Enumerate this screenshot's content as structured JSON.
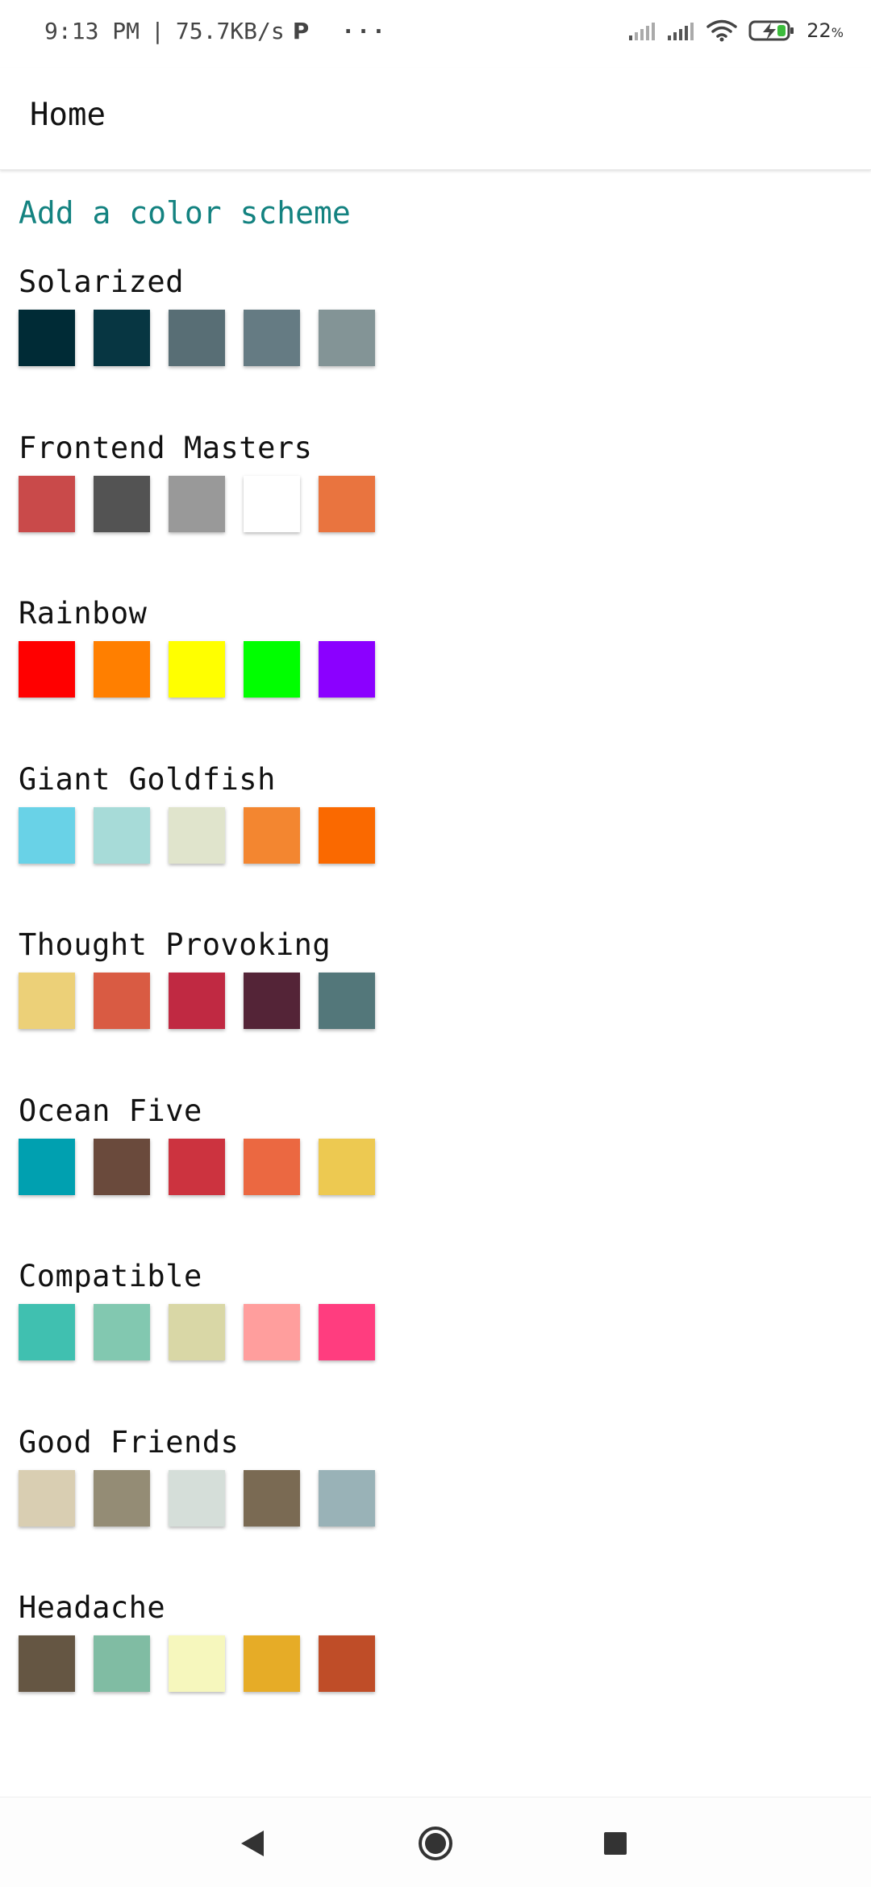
{
  "status_bar": {
    "time": "9:13 PM",
    "separator": "|",
    "network_speed": "75.7KB/s",
    "more": "···",
    "battery_level": "22",
    "battery_unit": "%"
  },
  "app_bar": {
    "title": "Home"
  },
  "add_scheme_label": "Add a color scheme",
  "colors": {
    "link": "#138280"
  },
  "schemes": [
    {
      "name": "Solarized",
      "colors": [
        "#002b36",
        "#073642",
        "#586e75",
        "#657b83",
        "#839496"
      ]
    },
    {
      "name": "Frontend Masters",
      "colors": [
        "#c94a4a",
        "#535353",
        "#999999",
        "#ffffff",
        "#e9743f"
      ]
    },
    {
      "name": "Rainbow",
      "colors": [
        "#ff0000",
        "#ff7f00",
        "#ffff00",
        "#00ff00",
        "#8b00ff"
      ]
    },
    {
      "name": "Giant Goldfish",
      "colors": [
        "#69d2e7",
        "#a7dbd8",
        "#e0e4cc",
        "#f38630",
        "#fa6900"
      ]
    },
    {
      "name": "Thought Provoking",
      "colors": [
        "#ecd078",
        "#d95b43",
        "#c02942",
        "#542437",
        "#53777a"
      ]
    },
    {
      "name": "Ocean Five",
      "colors": [
        "#00a0b0",
        "#6a4a3c",
        "#cc333f",
        "#eb6841",
        "#edc951"
      ]
    },
    {
      "name": "Compatible",
      "colors": [
        "#40c0b0",
        "#82c8b0",
        "#d9d7a6",
        "#ff9e9d",
        "#ff3d7f"
      ]
    },
    {
      "name": "Good Friends",
      "colors": [
        "#d9ceb2",
        "#948c75",
        "#d5ded9",
        "#7a6a53",
        "#99b2b7"
      ]
    },
    {
      "name": "Headache",
      "colors": [
        "#655643",
        "#80bca3",
        "#f6f7bd",
        "#e6ac27",
        "#bf4d28"
      ]
    }
  ],
  "nav_bar": {
    "back_icon": "back-triangle-icon",
    "home_icon": "home-circle-icon",
    "recents_icon": "recents-square-icon"
  }
}
